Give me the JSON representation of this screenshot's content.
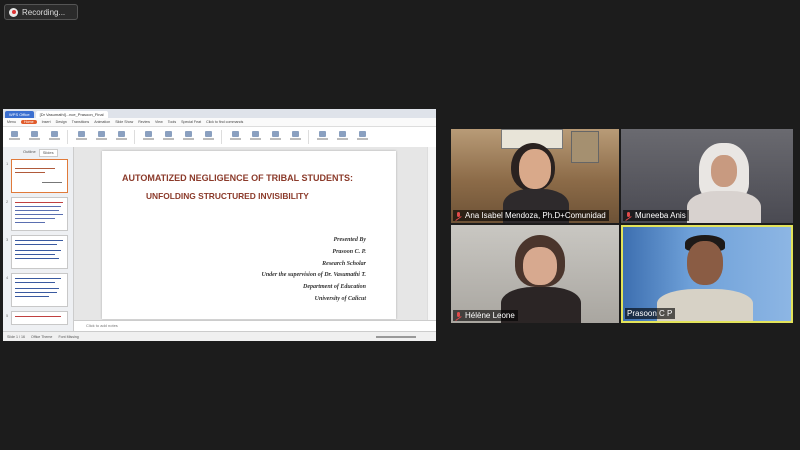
{
  "recording": {
    "label": "Recording..."
  },
  "share": {
    "tabs": [
      "WPS Office",
      "[Dr Vasumathi]...nce_Prasoon_Final"
    ],
    "menu": [
      "Menu",
      "Home",
      "Insert",
      "Design",
      "Transitions",
      "Animation",
      "Slide Show",
      "Review",
      "View",
      "Tools",
      "Special Feat",
      "Click to find commands"
    ],
    "menu_active": "Home",
    "panel_tabs": [
      "Outline",
      "Slides"
    ],
    "panel_active": "Slides",
    "slide_numbers": [
      "1",
      "2",
      "3",
      "4",
      "5"
    ],
    "notes_placeholder": "Click to add notes",
    "status": [
      "Slide 1 / 16",
      "Office Theme",
      "Font Missing"
    ]
  },
  "slide": {
    "title_line1": "AUTOMATIZED NEGLIGENCE OF TRIBAL STUDENTS:",
    "title_line2": "UNFOLDING STRUCTURED INVISIBILITY",
    "presented_by": "Presented By",
    "presenter": "Prasoon C. P.",
    "role": "Research Scholar",
    "supervision": "Under the supervision of Dr. Vasumathi T.",
    "department": "Department of Education",
    "university": "University of Calicut"
  },
  "participants": [
    {
      "name": "Ana Isabel Mendoza, Ph.D+Comunidad"
    },
    {
      "name": "Muneeba Anis"
    },
    {
      "name": "Hélène Leone"
    },
    {
      "name": "Prasoon C P"
    }
  ]
}
